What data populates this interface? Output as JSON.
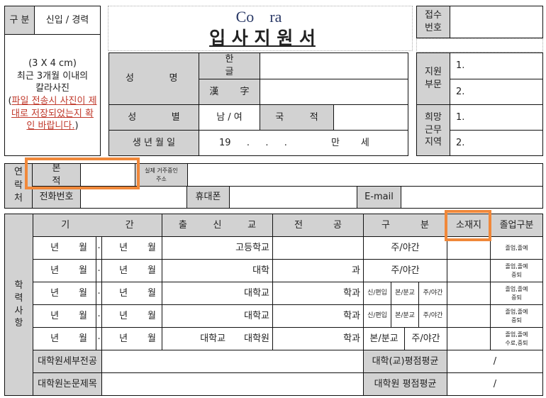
{
  "form": {
    "logo_text": "Co    ra",
    "title": "입 사 지 원 서",
    "category_label": "구 분",
    "category_value": "신입 / 경력",
    "photo": {
      "size": "(3 X 4 cm)",
      "line1": "최근 3개월 이내의",
      "line2": "칼라사진",
      "warning": "파일 전송시 사진이 제대로 저장되었는지 확인 바랍니다."
    },
    "receipt_label": "접수\n번호",
    "personal": {
      "name_label": "성 명",
      "hangul_label": "한 글",
      "hanja_label": "漢 字",
      "gender_label": "성 별",
      "gender_value": "남 / 여",
      "nationality_label": "국 적",
      "birth_label": "생 년 월 일",
      "birth_value": "19 . . .",
      "age_prefix": "만",
      "age_suffix": "세"
    },
    "apply": {
      "division_label": "지원\n부문",
      "division_items": [
        "1.",
        "2."
      ],
      "region_label": "희망\n근무\n지역",
      "region_items": [
        "1.",
        "2."
      ]
    },
    "contact": {
      "section_label": "연\n락\n처",
      "domicile_label": "본 적",
      "address_label": "실제 거주중인\n주소",
      "phone_label": "전화번호",
      "mobile_label": "휴대폰",
      "email_label": "E-mail"
    },
    "education": {
      "section_label": "학\n력\n사\n항",
      "headers": {
        "period_a": "기",
        "period_b": "간",
        "school": "출 신 교",
        "major": "전 공",
        "division": "구 분",
        "location": "소재지",
        "graduation": "졸업구분"
      },
      "year_label": "년",
      "month_label": "월",
      "dash": "-",
      "rows": [
        {
          "school": "고등학교",
          "major": "",
          "division": "주/야간",
          "graduation": "졸업,졸예"
        },
        {
          "school": "대학",
          "major": "과",
          "division": "주/야간",
          "graduation": "졸업,졸예\n중퇴"
        },
        {
          "school": "대학교",
          "major": "학과",
          "division_parts": [
            "신/편입",
            "본/분교",
            "주/야간"
          ],
          "graduation": "졸업,졸예\n중퇴"
        },
        {
          "school": "대학교",
          "major": "학과",
          "division_parts": [
            "신/편입",
            "본/분교",
            "주/야간"
          ],
          "graduation": "졸업,졸예\n중퇴"
        },
        {
          "school_a": "대학교",
          "school_b": "대학원",
          "major": "학과",
          "division_parts": [
            "본/분교",
            "주/야간"
          ],
          "graduation": "졸업,졸예\n수료,중퇴"
        }
      ],
      "grad_major_label": "대학원세부전공",
      "thesis_label": "대학원논문제목",
      "univ_gpa_label": "대학(교)평점평균",
      "grad_gpa_label": "대학원 평점평균",
      "gpa_sep": "/"
    }
  }
}
